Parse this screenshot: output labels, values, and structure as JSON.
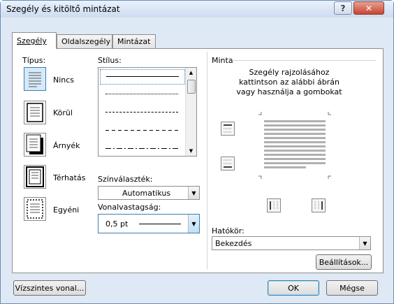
{
  "window": {
    "title": "Szegély és kitöltő mintázat",
    "help_label": "?",
    "close_label": "✕"
  },
  "tabs": [
    {
      "label": "Szegély",
      "active": true
    },
    {
      "label": "Oldalszegély",
      "active": false
    },
    {
      "label": "Mintázat",
      "active": false
    }
  ],
  "setting": {
    "heading": "Típus:",
    "items": [
      {
        "label": "Nincs",
        "icon": "none-border-icon",
        "selected": true
      },
      {
        "label": "Körül",
        "icon": "box-border-icon",
        "selected": false
      },
      {
        "label": "Árnyék",
        "icon": "shadow-border-icon",
        "selected": false
      },
      {
        "label": "Térhatás",
        "icon": "3d-border-icon",
        "selected": false
      },
      {
        "label": "Egyéni",
        "icon": "custom-border-icon",
        "selected": false
      }
    ]
  },
  "style": {
    "heading": "Stílus:",
    "line_styles": [
      "solid",
      "dotted",
      "dashed-small",
      "dashed",
      "dash-dot"
    ],
    "color_label": "Színválaszték:",
    "color_value": "Automatikus",
    "width_label": "Vonalvastagság:",
    "width_value": "0,5 pt"
  },
  "preview": {
    "heading": "Minta",
    "instructions": "Szegély rajzolásához kattintson az alábbi ábrán vagy használja a gombokat"
  },
  "apply_to": {
    "label": "Hatókör:",
    "value": "Bekezdés"
  },
  "buttons": {
    "options": "Beállítások...",
    "horizontal_line": "Vízszintes vonal...",
    "ok": "OK",
    "cancel": "Mégse"
  },
  "colors": {
    "accent": "#3c7fb1",
    "selection": "#d6e9f8",
    "close": "#c7452f"
  }
}
